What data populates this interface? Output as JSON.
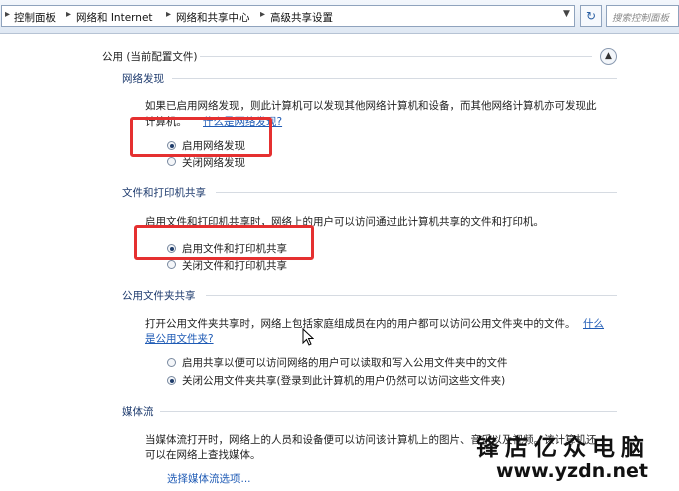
{
  "address_bar": {
    "breadcrumbs": [
      "控制面板",
      "网络和 Internet",
      "网络和共享中心",
      "高级共享设置"
    ],
    "search_placeholder": "搜索控制面板"
  },
  "profile": {
    "title": "公用 (当前配置文件)"
  },
  "network_discovery": {
    "heading": "网络发现",
    "description": "如果已启用网络发现，则此计算机可以发现其他网络计算机和设备，而其他网络计算机亦可发现此",
    "description_line2": "计算机。",
    "link": "什么是网络发现?",
    "options": [
      {
        "label": "启用网络发现",
        "selected": true
      },
      {
        "label": "关闭网络发现",
        "selected": false
      }
    ]
  },
  "file_printer_sharing": {
    "heading": "文件和打印机共享",
    "description": "启用文件和打印机共享时，网络上的用户可以访问通过此计算机共享的文件和打印机。",
    "options": [
      {
        "label": "启用文件和打印机共享",
        "selected": true
      },
      {
        "label": "关闭文件和打印机共享",
        "selected": false
      }
    ]
  },
  "public_folder_sharing": {
    "heading": "公用文件夹共享",
    "description": "打开公用文件夹共享时，网络上包括家庭组成员在内的用户都可以访问公用文件夹中的文件。",
    "link_line1": "什么",
    "link_line2": "是公用文件夹?",
    "options": [
      {
        "label": "启用共享以便可以访问网络的用户可以读取和写入公用文件夹中的文件",
        "selected": false
      },
      {
        "label": "关闭公用文件夹共享(登录到此计算机的用户仍然可以访问这些文件夹)",
        "selected": true
      }
    ]
  },
  "media_streaming": {
    "heading": "媒体流",
    "description": "当媒体流打开时，网络上的人员和设备便可以访问该计算机上的图片、音乐以及视频。该计算机还",
    "description_line2": "可以在网络上查找媒体。",
    "link": "选择媒体流选项..."
  },
  "watermark": {
    "line1": "锋店亿众电脑",
    "line2": "www.yzdn.net"
  },
  "colors": {
    "highlight_box": "#e53030",
    "link": "#1f5bb5"
  }
}
